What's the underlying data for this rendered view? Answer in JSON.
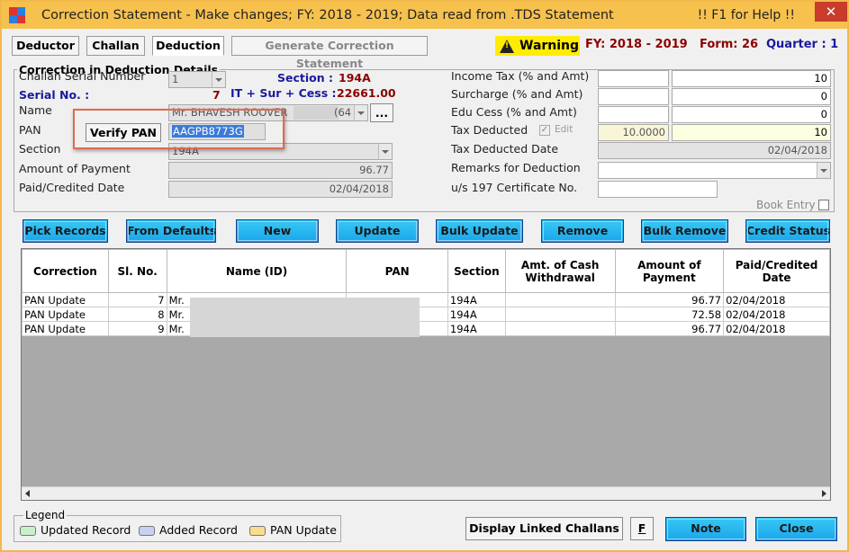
{
  "window": {
    "title": "Correction Statement - Make changes;  FY: 2018 - 2019;  Data read from .TDS Statement",
    "help": "!!   F1 for Help   !!",
    "close": "✕"
  },
  "tabs": [
    {
      "label": "Deductor"
    },
    {
      "label": "Challan"
    },
    {
      "label": "Deduction"
    },
    {
      "label": "Generate Correction Statement"
    }
  ],
  "header": {
    "warning": "Warning",
    "fy": "FY: 2018 - 2019",
    "form": "Form: 26",
    "quarter": "Quarter : 1"
  },
  "details": {
    "legend": "Correction in Deduction Details",
    "challan_serial_label": "Challan Serial Number",
    "challan_serial_value": "1",
    "serial_no_label": "Serial No. :",
    "serial_no_value": "7",
    "section_label_top": "Section :",
    "section_value_top": "194A",
    "it_sur_cess_label": "IT + Sur + Cess :",
    "it_sur_cess_value": "22661.00",
    "name_label": "Name",
    "name_value": "Mr. BHAVESH ROOVER",
    "name_id": "(64",
    "pan_label": "PAN",
    "verify_pan": "Verify PAN",
    "pan_value": "AAGPB8773G",
    "section_label": "Section",
    "section_value": "194A",
    "amount_label": "Amount of Payment",
    "amount_value": "96.77",
    "paid_date_label": "Paid/Credited Date",
    "paid_date_value": "02/04/2018",
    "income_tax_label": "Income Tax (% and Amt)",
    "income_tax_amt": "10",
    "surcharge_label": "Surcharge (% and Amt)",
    "surcharge_amt": "0",
    "edu_cess_label": "Edu Cess (% and Amt)",
    "edu_cess_amt": "0",
    "tax_deducted_label": "Tax Deducted",
    "edit_label": "Edit",
    "tax_deducted_rate": "10.0000",
    "tax_deducted_amt": "10",
    "tax_deducted_date_label": "Tax Deducted Date",
    "tax_deducted_date_value": "02/04/2018",
    "remarks_label": "Remarks for Deduction",
    "cert_label": "u/s 197 Certificate No.",
    "book_entry_label": "Book Entry"
  },
  "actions": [
    {
      "label": "Pick Records"
    },
    {
      "label": "From Defaults"
    },
    {
      "label": "New"
    },
    {
      "label": "Update"
    },
    {
      "label": "Bulk Update"
    },
    {
      "label": "Remove"
    },
    {
      "label": "Bulk Remove"
    },
    {
      "label": "Credit Status"
    }
  ],
  "table": {
    "columns": [
      "Correction",
      "Sl. No.",
      "Name (ID)",
      "PAN",
      "Section",
      "Amt. of Cash Withdrawal",
      "Amount of Payment",
      "Paid/Credited Date"
    ],
    "rows": [
      {
        "correction": "PAN Update",
        "sl": "7",
        "name": "Mr.",
        "pan": "",
        "section": "194A",
        "cash": "",
        "amount": "96.77",
        "date": "02/04/2018"
      },
      {
        "correction": "PAN Update",
        "sl": "8",
        "name": "Mr.",
        "pan": "",
        "section": "194A",
        "cash": "",
        "amount": "72.58",
        "date": "02/04/2018"
      },
      {
        "correction": "PAN Update",
        "sl": "9",
        "name": "Mr.",
        "pan": "",
        "section": "194A",
        "cash": "",
        "amount": "96.77",
        "date": "02/04/2018"
      }
    ]
  },
  "legend": {
    "title": "Legend",
    "items": [
      {
        "label": "Updated Record",
        "color": "#c8f0c8"
      },
      {
        "label": "Added Record",
        "color": "#c8d0f0"
      },
      {
        "label": "PAN Update",
        "color": "#f8dc90"
      }
    ]
  },
  "footer": {
    "linked_challans": "Display Linked Challans",
    "f_button": "F",
    "note": "Note",
    "close": "Close"
  },
  "colors": {
    "titlebar": "#f7c14e",
    "warning": "#ffec00",
    "action_button": "#1aa6ea",
    "highlight_red": "#e06a50"
  }
}
